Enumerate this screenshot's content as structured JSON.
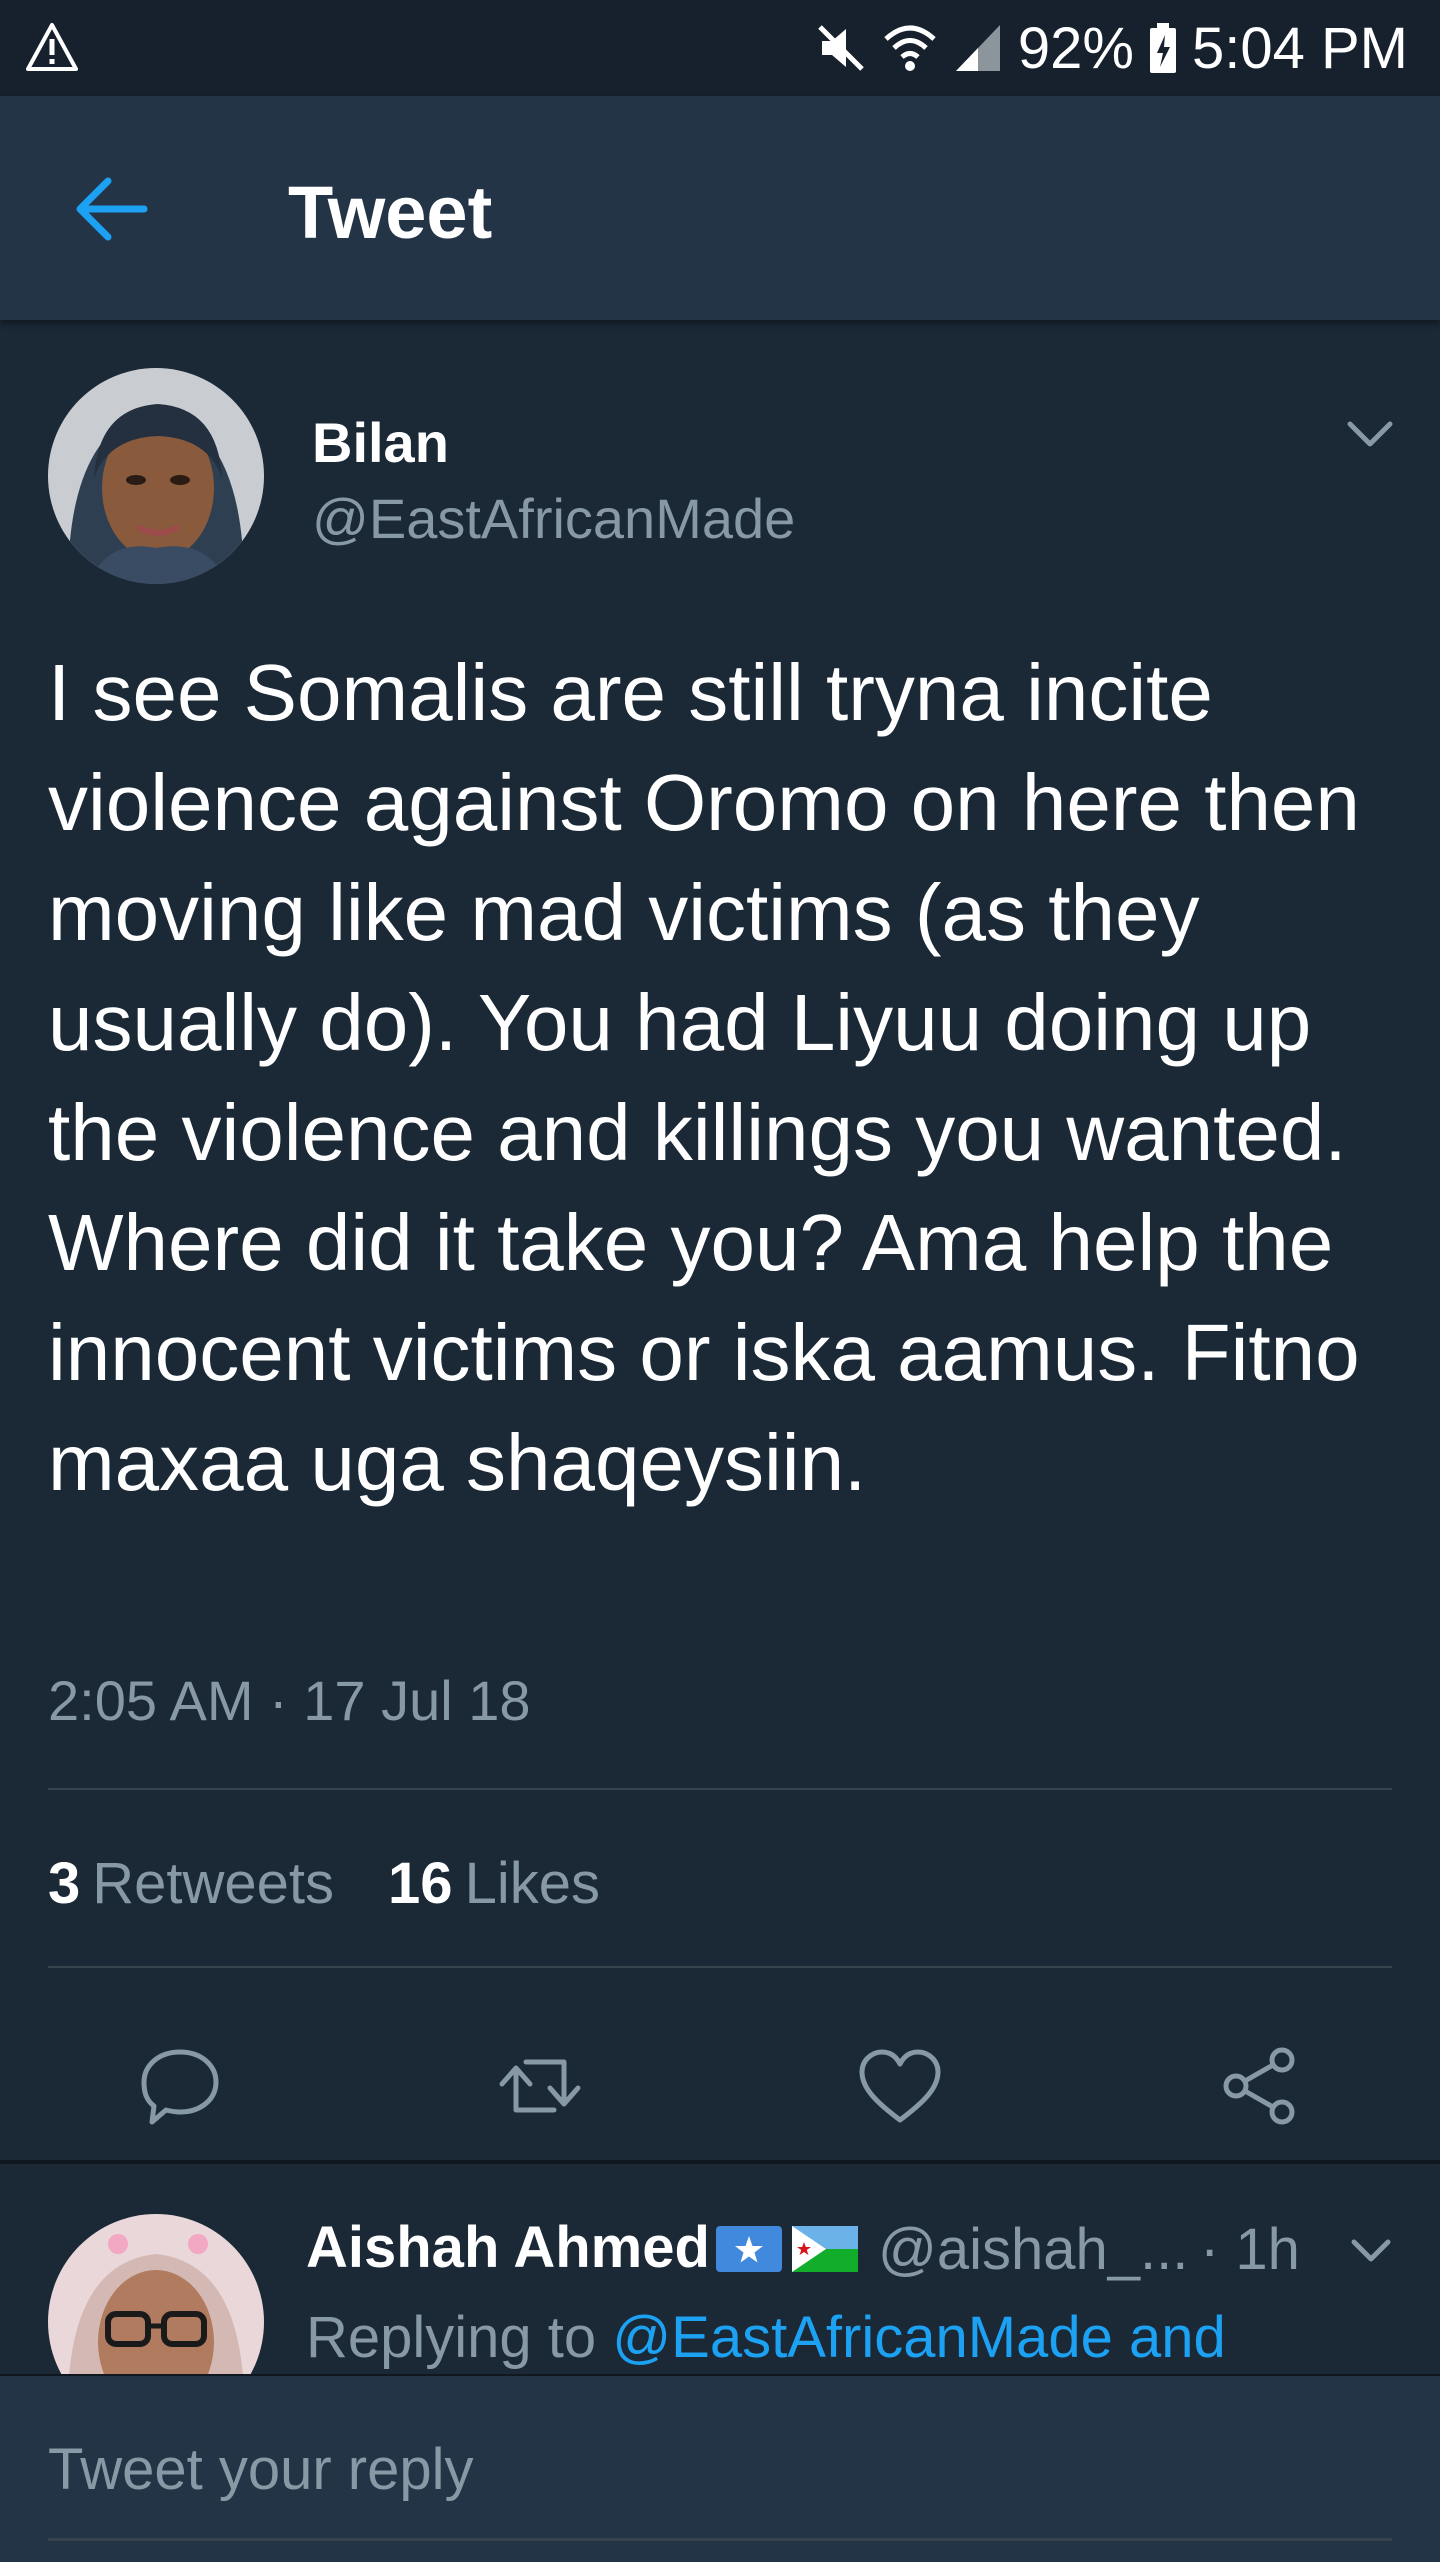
{
  "status_bar": {
    "battery": "92%",
    "time": "5:04 PM"
  },
  "app_bar": {
    "title": "Tweet"
  },
  "tweet": {
    "author_name": "Bilan",
    "author_handle": "@EastAfricanMade",
    "text": "I see Somalis are still tryna incite violence against Oromo on here then moving like mad victims (as they usually do). You had Liyuu doing up the violence and killings you wanted. Where did it take you? Ama help the innocent victims or iska aamus. Fitno maxaa uga shaqeysiin.",
    "timestamp": "2:05 AM · 17 Jul 18",
    "retweet_count": "3",
    "retweet_label": "Retweets",
    "like_count": "16",
    "like_label": "Likes"
  },
  "reply": {
    "author_name": "Aishah Ahmed",
    "author_handle": "@aishah_...",
    "time": "· 1h",
    "replying_prefix": "Replying to",
    "replying_to": "@EastAfricanMade and"
  },
  "composer": {
    "placeholder": "Tweet your reply"
  },
  "colors": {
    "background": "#1b2836",
    "header": "#243447",
    "accent": "#1da1f2",
    "muted": "#8899a6"
  },
  "icons": [
    "warning-icon",
    "mute-icon",
    "wifi-icon",
    "signal-icon",
    "battery-icon",
    "back-arrow-icon",
    "chevron-down-icon",
    "reply-icon",
    "retweet-icon",
    "like-icon",
    "share-icon",
    "somalia-flag-icon",
    "djibouti-flag-icon"
  ]
}
